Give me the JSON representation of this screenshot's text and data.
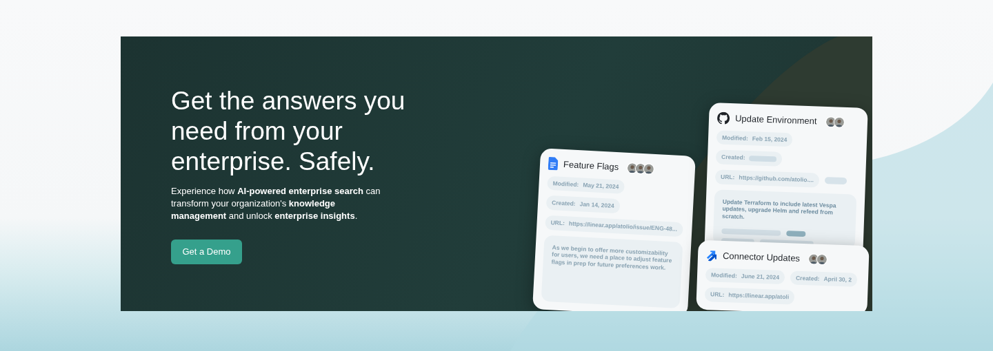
{
  "hero": {
    "headline": "Get the answers you need from your enterprise. Safely.",
    "description": "Experience how **AI-powered enterprise search** can transform your organization's **knowledge management** and unlock **enterprise insights**.",
    "cta": "Get a Demo"
  },
  "cards": [
    {
      "kind": "doc",
      "title": "Feature Flags",
      "modified_label": "Modified:",
      "modified": "May 21, 2024",
      "created_label": "Created:",
      "created": "Jan 14, 2024",
      "url_label": "URL:",
      "url": "https://linear.app/atolio/issue/ENG-48...",
      "body": "As we begin to offer more customizability for users, we need a place to adjust feature flags in prep for future preferences work."
    },
    {
      "kind": "github",
      "title": "Update Environment",
      "modified_label": "Modified:",
      "modified": "Feb 15, 2024",
      "created_label": "Created:",
      "url_label": "URL:",
      "url": "https://github.com/atolio....",
      "body": "Update Terraform to include latest Vespa updates, upgrade Helm and refeed from scratch."
    },
    {
      "kind": "jira",
      "title": "Connector Updates",
      "modified_label": "Modified:",
      "modified": "June 21, 2024",
      "created_label": "Created:",
      "created": "April 30, 2",
      "url_label": "URL:",
      "url": "https://linear.app/atoli"
    }
  ]
}
